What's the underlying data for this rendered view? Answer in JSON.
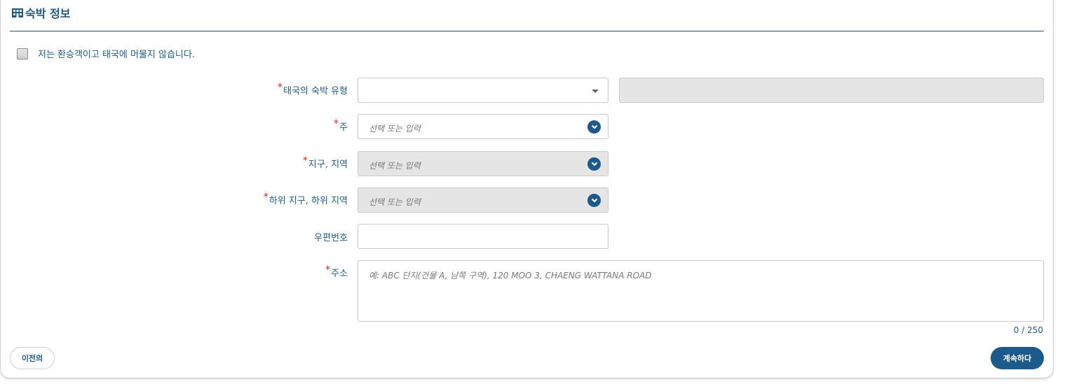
{
  "section": {
    "title": "숙박 정보",
    "icon": "building-icon"
  },
  "transit_checkbox": {
    "label": "저는 환승객이고 태국에 머물지 않습니다.",
    "checked": false
  },
  "fields": {
    "accommodation_type": {
      "label": "태국의 숙박 유형",
      "value": "",
      "required": true
    },
    "province": {
      "label": "주",
      "placeholder": "선택 또는 입력",
      "required": true
    },
    "district": {
      "label": "지구, 지역",
      "placeholder": "선택 또는 입력",
      "required": true
    },
    "subdistrict": {
      "label": "하위 지구, 하위 지역",
      "placeholder": "선택 또는 입력",
      "required": true
    },
    "postal_code": {
      "label": "우편번호",
      "value": "",
      "required": false
    },
    "address": {
      "label": "주소",
      "placeholder": "예: ABC 단지(건물 A, 남쪽 구역), 120 MOO 3, CHAENG WATTANA ROAD",
      "required": true,
      "counter": "0 / 250"
    }
  },
  "required_marker": "*",
  "buttons": {
    "prev": "이전의",
    "next": "계속하다"
  },
  "colors": {
    "primary": "#1d5a8c",
    "required": "#e0241a",
    "disabled_bg": "#e5e5e5"
  }
}
